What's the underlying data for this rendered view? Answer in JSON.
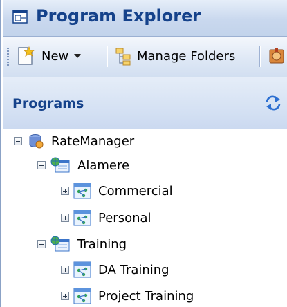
{
  "window": {
    "title": "Program Explorer"
  },
  "toolbar": {
    "new_label": "New",
    "manage_folders_label": "Manage Folders"
  },
  "panel": {
    "title": "Programs"
  },
  "tree": {
    "root": {
      "label": "RateManager",
      "expanded": true
    },
    "alamere": {
      "label": "Alamere",
      "expanded": true
    },
    "commercial": {
      "label": "Commercial",
      "expanded": false
    },
    "personal": {
      "label": "Personal",
      "expanded": false
    },
    "training": {
      "label": "Training",
      "expanded": true
    },
    "da_training": {
      "label": "DA Training",
      "expanded": false
    },
    "project_training": {
      "label": "Project Training",
      "expanded": false
    }
  },
  "icons": {
    "title": "window-icon",
    "new": "new-document-icon",
    "manage_folders": "manage-folders-icon",
    "overflow": "toolbar-overflow-icon",
    "refresh": "refresh-icon",
    "root": "database-icon",
    "folder": "globe-folder-icon",
    "program": "program-icon"
  },
  "colors": {
    "title_text": "#15428b",
    "header_gradient": "#c9d8ee",
    "border": "#8ba2c6"
  }
}
